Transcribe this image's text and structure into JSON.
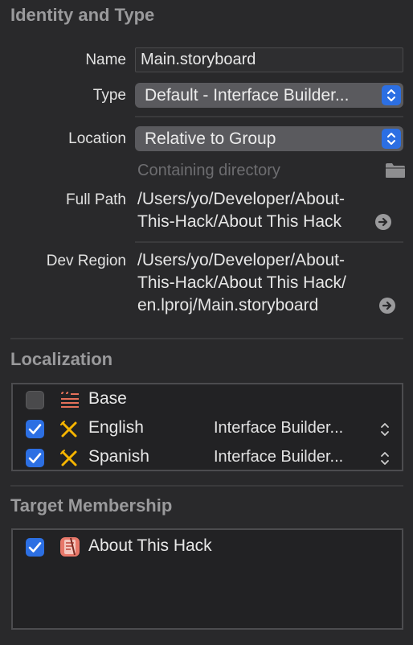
{
  "identity": {
    "title": "Identity and Type",
    "name_label": "Name",
    "name_value": "Main.storyboard",
    "type_label": "Type",
    "type_value": "Default - Interface Builder...",
    "location_label": "Location",
    "location_value": "Relative to Group",
    "containing_directory": "Containing directory",
    "full_path_label": "Full Path",
    "full_path_lines": [
      "/Users/yo/Developer/About-",
      "This-Hack/About This Hack"
    ],
    "dev_region_label": "Dev Region",
    "dev_region_lines": [
      "/Users/yo/Developer/About-",
      "This-Hack/About This Hack/",
      "en.lproj/Main.storyboard"
    ]
  },
  "localization": {
    "title": "Localization",
    "rows": [
      {
        "label": "Base",
        "checked": false,
        "icon": "base-localization-icon",
        "value": ""
      },
      {
        "label": "English",
        "checked": true,
        "icon": "interface-builder-icon",
        "value": "Interface Builder..."
      },
      {
        "label": "Spanish",
        "checked": true,
        "icon": "interface-builder-icon",
        "value": "Interface Builder..."
      }
    ]
  },
  "target_membership": {
    "title": "Target Membership",
    "rows": [
      {
        "label": "About This Hack",
        "checked": true,
        "icon": "app-target-icon"
      }
    ]
  },
  "colors": {
    "background": "#29292b",
    "accent": "#2c6fe3",
    "section_title": "#9a9a9c"
  }
}
